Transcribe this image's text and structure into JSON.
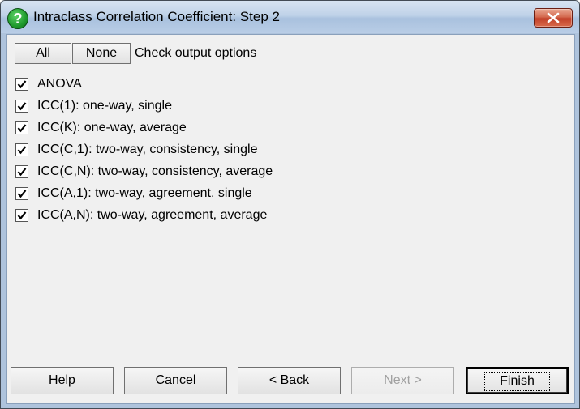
{
  "window": {
    "title": "Intraclass Correlation Coefficient: Step 2",
    "close_label": "×"
  },
  "header": {
    "all_label": "All",
    "none_label": "None",
    "caption": "Check output options"
  },
  "options": [
    {
      "label": "ANOVA",
      "checked": true
    },
    {
      "label": "ICC(1): one-way, single",
      "checked": true
    },
    {
      "label": "ICC(K): one-way, average",
      "checked": true
    },
    {
      "label": "ICC(C,1): two-way, consistency, single",
      "checked": true
    },
    {
      "label": "ICC(C,N): two-way, consistency, average",
      "checked": true
    },
    {
      "label": "ICC(A,1): two-way, agreement, single",
      "checked": true
    },
    {
      "label": "ICC(A,N): two-way, agreement, average",
      "checked": true
    }
  ],
  "footer": {
    "help_label": "Help",
    "cancel_label": "Cancel",
    "back_label": "< Back",
    "next_label": "Next >",
    "finish_label": "Finish"
  },
  "colors": {
    "titlebar": "#bfd2e8",
    "close_button": "#c2412a",
    "client_bg": "#f0f0f0",
    "disabled_text": "#a0a0a0"
  }
}
